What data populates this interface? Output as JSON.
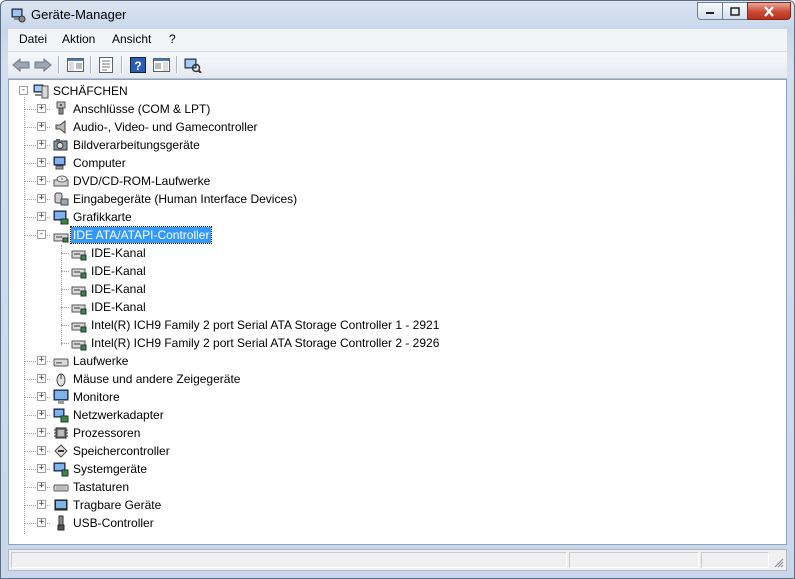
{
  "window": {
    "title": "Geräte-Manager"
  },
  "menu": {
    "items": [
      "Datei",
      "Aktion",
      "Ansicht",
      "?"
    ]
  },
  "toolbar": {
    "buttons": [
      "back-icon",
      "forward-icon",
      "show-hide-tree-icon",
      "properties-icon",
      "help-icon",
      "action-pane-icon",
      "scan-hardware-icon"
    ]
  },
  "tree": {
    "root": "SCHÄFCHEN",
    "categories": [
      {
        "label": "Anschlüsse (COM & LPT)",
        "icon": "port-icon",
        "expanded": false
      },
      {
        "label": "Audio-, Video- und Gamecontroller",
        "icon": "speaker-icon",
        "expanded": false
      },
      {
        "label": "Bildverarbeitungsgeräte",
        "icon": "camera-icon",
        "expanded": false
      },
      {
        "label": "Computer",
        "icon": "computer-icon",
        "expanded": false
      },
      {
        "label": "DVD/CD-ROM-Laufwerke",
        "icon": "dvd-drive-icon",
        "expanded": false
      },
      {
        "label": "Eingabegeräte (Human Interface Devices)",
        "icon": "hid-icon",
        "expanded": false
      },
      {
        "label": "Grafikkarte",
        "icon": "display-adapter-icon",
        "expanded": false
      },
      {
        "label": "IDE ATA/ATAPI-Controller",
        "icon": "ide-controller-icon",
        "expanded": true,
        "selected": true,
        "children": [
          "IDE-Kanal",
          "IDE-Kanal",
          "IDE-Kanal",
          "IDE-Kanal",
          "Intel(R) ICH9 Family 2 port Serial ATA Storage Controller 1 - 2921",
          "Intel(R) ICH9 Family 2 port Serial ATA Storage Controller 2 - 2926"
        ]
      },
      {
        "label": "Laufwerke",
        "icon": "disk-drive-icon",
        "expanded": false
      },
      {
        "label": "Mäuse und andere Zeigegeräte",
        "icon": "mouse-icon",
        "expanded": false
      },
      {
        "label": "Monitore",
        "icon": "monitor-icon",
        "expanded": false
      },
      {
        "label": "Netzwerkadapter",
        "icon": "network-adapter-icon",
        "expanded": false
      },
      {
        "label": "Prozessoren",
        "icon": "processor-icon",
        "expanded": false
      },
      {
        "label": "Speichercontroller",
        "icon": "storage-controller-icon",
        "expanded": false
      },
      {
        "label": "Systemgeräte",
        "icon": "system-devices-icon",
        "expanded": false
      },
      {
        "label": "Tastaturen",
        "icon": "keyboard-icon",
        "expanded": false
      },
      {
        "label": "Tragbare Geräte",
        "icon": "portable-device-icon",
        "expanded": false
      },
      {
        "label": "USB-Controller",
        "icon": "usb-icon",
        "expanded": false
      }
    ]
  },
  "colors": {
    "selection": "#3399ff",
    "window_frame": "#c9d7e9",
    "close_button": "#c94a33"
  }
}
